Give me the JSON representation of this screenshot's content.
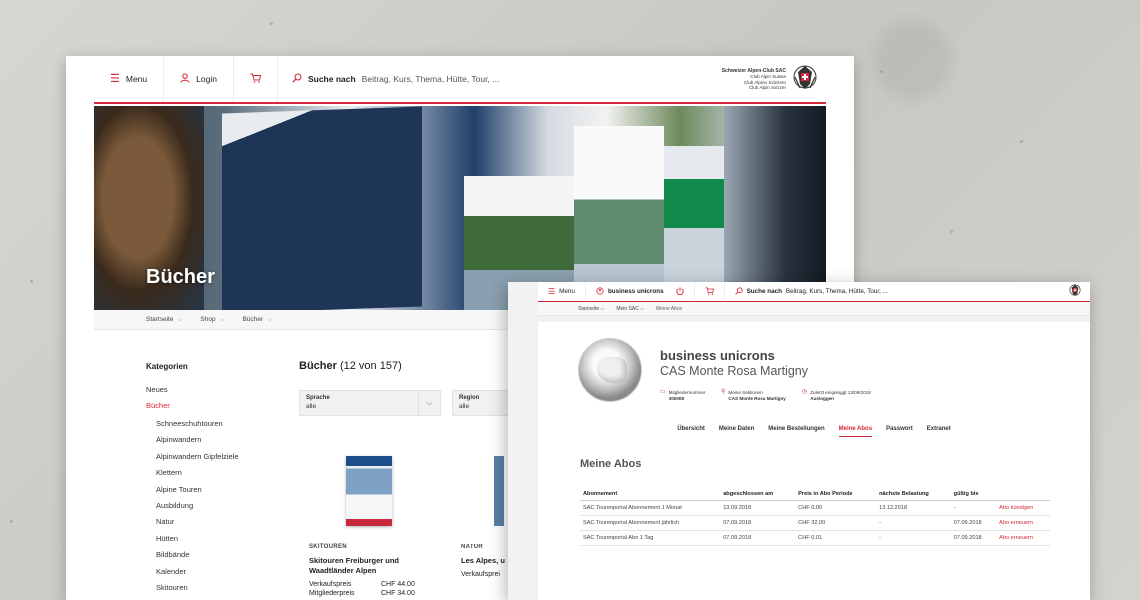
{
  "back_window": {
    "header": {
      "menu_label": "Menu",
      "login_label": "Login",
      "search_bold": "Suche nach",
      "search_placeholder": "Beitrag, Kurs, Thema, Hütte, Tour, ...",
      "brand_lines": [
        "Schweizer Alpen-Club SAC",
        "Club Alpin Suisse",
        "Club Alpino Svizzero",
        "Club Alpin Svizzer"
      ]
    },
    "hero_title": "Bücher",
    "breadcrumb": [
      "Startseite",
      "Shop",
      "Bücher"
    ],
    "categories_title": "Kategorien",
    "categories": [
      "Neues",
      "Bücher"
    ],
    "subcategories": [
      "Schneeschuhtouren",
      "Alpinwandern",
      "Alpinwandern Gipfelziele",
      "Klettern",
      "Alpine Touren",
      "Ausbildung",
      "Natur",
      "Hütten",
      "Bildbände",
      "Kalender",
      "Skitouren"
    ],
    "books_title": "Bücher",
    "books_count": "(12 von 157)",
    "filters": [
      {
        "label": "Sprache",
        "value": "alle"
      },
      {
        "label": "Region",
        "value": "alle"
      }
    ],
    "books": [
      {
        "tag": "SKITOUREN",
        "title": "Skitouren Freiburger und Waadtländer Alpen",
        "price_label": "Verkaufspreis",
        "price": "CHF 44.00",
        "member_label": "Mitgliederpreis",
        "member_price": "CHF 34.00"
      },
      {
        "tag": "NATUR",
        "title": "Les Alpes, u",
        "price_label": "Verkaufsprei"
      }
    ]
  },
  "front_window": {
    "header": {
      "menu_label": "Menu",
      "user_label": "business unicrons",
      "search_bold": "Suche nach",
      "search_placeholder": "Beitrag, Kurs, Thema, Hütte, Tour, ..."
    },
    "breadcrumb": [
      "Startseite",
      "Mein SAC",
      "Meine Abos"
    ],
    "profile": {
      "name": "business unicrons",
      "section": "CAS Monte Rosa Martigny",
      "member_label": "Mitgliedernummer",
      "member_value": "300008",
      "section_label": "Meine Sektionen",
      "section_value": "CAS Monte Rosa Martigny",
      "login_label": "Zuletzt eingeloggt 13/09/2018",
      "logout_label": "Ausloggen"
    },
    "tabs": [
      "Übersicht",
      "Meine Daten",
      "Meine Bestellungen",
      "Meine Abos",
      "Passwort",
      "Extranet"
    ],
    "active_tab": "Meine Abos",
    "abos_title": "Meine Abos",
    "table": {
      "headers": [
        "Abonnement",
        "abgeschlossen am",
        "Preis in Abo Periode",
        "nächste Belastung",
        "gültig bis",
        ""
      ],
      "rows": [
        [
          "SAC Tourenportal Abonnement 1 Monat",
          "13.09.2018",
          "CHF 0.00",
          "13.12.2018",
          "-",
          "Abo kündigen"
        ],
        [
          "SAC Tourenportal Abonnement jährlich",
          "07.09.2018",
          "CHF 32.00",
          "-",
          "07.09.2018",
          "Abo erneuern"
        ],
        [
          "SAC Tourenportal Abo 1 Tag",
          "07.09.2018",
          "CHF 0.01",
          "-",
          "07.09.2018",
          "Abo erneuern"
        ]
      ]
    }
  },
  "colors": {
    "accent": "#d6283b"
  }
}
